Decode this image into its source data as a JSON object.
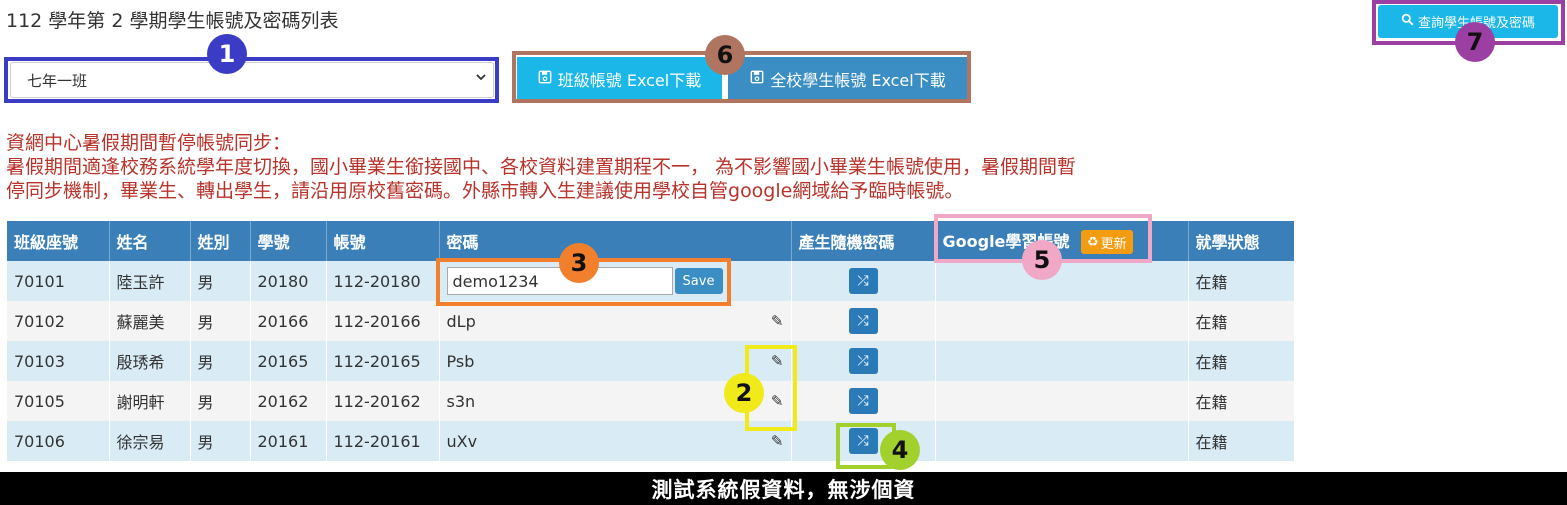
{
  "page": {
    "title": "112 學年第 2 學期學生帳號及密碼列表"
  },
  "toolbar": {
    "query_label": "查詢學生帳號及密碼",
    "class_select_value": "七年一班",
    "class_excel_label": "班級帳號 Excel下載",
    "school_excel_label": "全校學生帳號 Excel下載"
  },
  "notice": {
    "line1": "資網中心暑假期間暫停帳號同步：",
    "line2": "暑假期間適逢校務系統學年度切換，國小畢業生銜接國中、各校資料建置期程不一， 為不影響國小畢業生帳號使用，暑假期間暫",
    "line3": "停同步機制，畢業生、轉出學生，請沿用原校舊密碼。外縣市轉入生建議使用學校自管google網域給予臨時帳號。"
  },
  "table": {
    "headers": {
      "seat": "班級座號",
      "name": "姓名",
      "gender": "姓別",
      "student_no": "學號",
      "account": "帳號",
      "password": "密碼",
      "random_pw": "產生隨機密碼",
      "google": "Google學習帳號",
      "status": "就學狀態"
    },
    "update_label": "更新",
    "save_label": "Save",
    "rows": [
      {
        "seat": "70101",
        "name": "陸玉許",
        "gender": "男",
        "student_no": "20180",
        "account": "112-20180",
        "password": "demo1234",
        "status": "在籍"
      },
      {
        "seat": "70102",
        "name": "蘇麗美",
        "gender": "男",
        "student_no": "20166",
        "account": "112-20166",
        "password": "dLp",
        "status": "在籍"
      },
      {
        "seat": "70103",
        "name": "殷琇希",
        "gender": "男",
        "student_no": "20165",
        "account": "112-20165",
        "password": "Psb",
        "status": "在籍"
      },
      {
        "seat": "70105",
        "name": "謝明軒",
        "gender": "男",
        "student_no": "20162",
        "account": "112-20162",
        "password": "s3n",
        "status": "在籍"
      },
      {
        "seat": "70106",
        "name": "徐宗易",
        "gender": "男",
        "student_no": "20161",
        "account": "112-20161",
        "password": "uXv",
        "status": "在籍"
      }
    ]
  },
  "markers": {
    "m1": "1",
    "m2": "2",
    "m3": "3",
    "m4": "4",
    "m5": "5",
    "m6": "6",
    "m7": "7"
  },
  "footer": {
    "text": "測試系統假資料，無涉個資"
  },
  "icons": {
    "query": "search-icon",
    "download": "floppy-disk-icon",
    "edit": "edit-icon",
    "shuffle": "shuffle-icon",
    "update": "recycle-icon",
    "dropdown": "chevron-down-icon"
  },
  "colors": {
    "primary": "#1ab7e8",
    "header_bg": "#3a7fb8",
    "notice_text": "#b8332b",
    "update_badge": "#f39c12"
  }
}
